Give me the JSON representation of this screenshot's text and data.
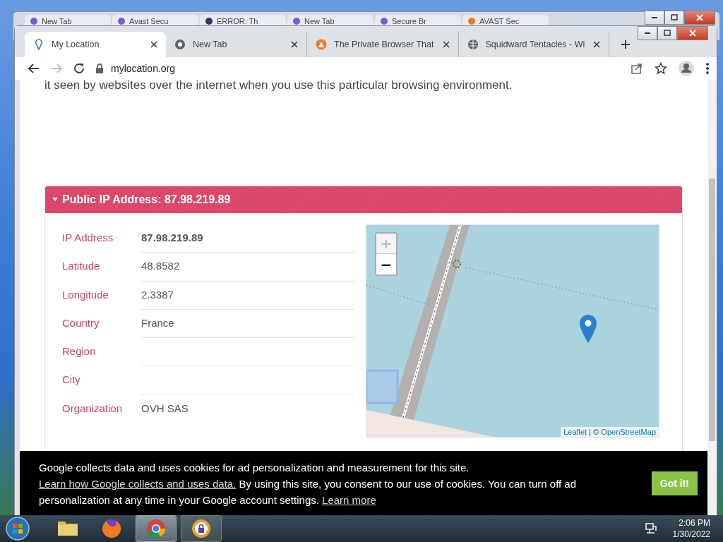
{
  "background_window": {
    "tabs": [
      {
        "title": "New Tab"
      },
      {
        "title": "Avast Secu"
      },
      {
        "title": "ERROR: Th"
      },
      {
        "title": "New Tab"
      },
      {
        "title": "Secure Br"
      },
      {
        "title": "AVAST Sec"
      }
    ]
  },
  "browser": {
    "tabs": [
      {
        "title": "My Location",
        "selected": true
      },
      {
        "title": "New Tab",
        "selected": false
      },
      {
        "title": "The Private Browser That",
        "selected": false
      },
      {
        "title": "Squidward Tentacles - Wi",
        "selected": false
      }
    ],
    "address": "mylocation.org"
  },
  "page": {
    "intro": "it seen by websites over the internet when you use this particular browsing environment.",
    "panel": {
      "title": "Public IP Address: 87.98.219.89",
      "expanded": true,
      "rows": [
        {
          "label": "IP Address",
          "value": "87.98.219.89",
          "emphasized": true
        },
        {
          "label": "Latitude",
          "value": "48.8582",
          "emphasized": false
        },
        {
          "label": "Longitude",
          "value": "2.3387",
          "emphasized": false
        },
        {
          "label": "Country",
          "value": "France",
          "emphasized": false
        },
        {
          "label": "Region",
          "emphasized": false
        },
        {
          "label": "City",
          "emphasized": false
        },
        {
          "label": "Organization",
          "value": "OVH SAS",
          "emphasized": false
        }
      ],
      "map": {
        "zoom_controls": [
          {
            "label": "+",
            "disabled": true
          },
          {
            "label": "−",
            "disabled": false
          }
        ],
        "attribution": [
          {
            "kind": "link",
            "text": "Leaflet"
          },
          {
            "kind": "text",
            "text": " | © "
          },
          {
            "kind": "link",
            "text": "OpenStreetMap"
          }
        ]
      }
    }
  },
  "cookie_banner": {
    "message": [
      {
        "kind": "text",
        "text": "Google collects data and uses cookies for ad personalization and measurement for this site. "
      },
      {
        "kind": "link",
        "text": "Learn how Google collects and uses data."
      },
      {
        "kind": "text",
        "text": " By using this site, you consent to our use of cookies. You can turn off ad personalization at any time in your Google account settings. "
      },
      {
        "kind": "link",
        "text": "Learn more"
      }
    ],
    "button": "Got it!"
  },
  "taskbar": {
    "apps": [
      {
        "selected": false
      },
      {
        "selected": false
      },
      {
        "selected": true
      },
      {
        "selected": false
      }
    ],
    "time": "2:06 PM",
    "date": "1/30/2022"
  }
}
